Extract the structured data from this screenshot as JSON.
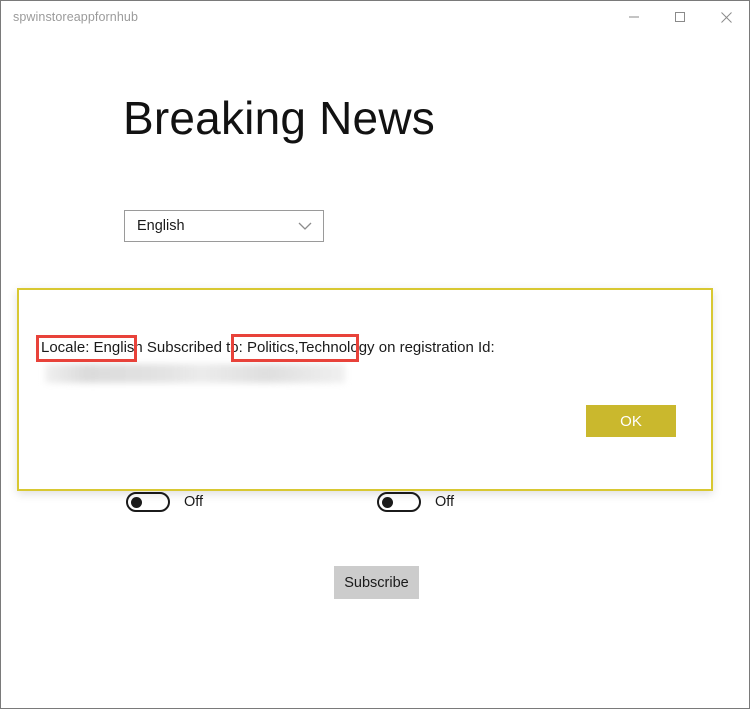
{
  "window": {
    "title": "spwinstoreappfornhub",
    "controls": {
      "minimize_label": "Minimize",
      "maximize_label": "Maximize",
      "close_label": "Close"
    }
  },
  "page": {
    "heading": "Breaking News"
  },
  "locale_select": {
    "name": "locale-dropdown",
    "selected": "English",
    "chevron_icon": "chevron-down-icon"
  },
  "toggles": [
    {
      "id": "toggle-1",
      "state_label": "Off",
      "checked": false
    },
    {
      "id": "toggle-2",
      "state_label": "Off",
      "checked": false
    }
  ],
  "subscribe_button": {
    "label": "Subscribe"
  },
  "dialog": {
    "message_prefix": "Locale: ",
    "locale_value": "English",
    "message_middle": " Subscribed to: ",
    "topics_value": "Politics,Technology",
    "message_suffix": " on registration Id:",
    "registration_id": "",
    "registration_id_redacted": true,
    "ok_label": "OK",
    "border_color": "#d8c832",
    "ok_button_color": "#cab82d"
  },
  "annotations": [
    {
      "name": "annotation-locale",
      "target_text": "Locale: English",
      "color": "#e8423a"
    },
    {
      "name": "annotation-topics",
      "target_text": "Politics,Technology",
      "color": "#e8423a"
    }
  ]
}
